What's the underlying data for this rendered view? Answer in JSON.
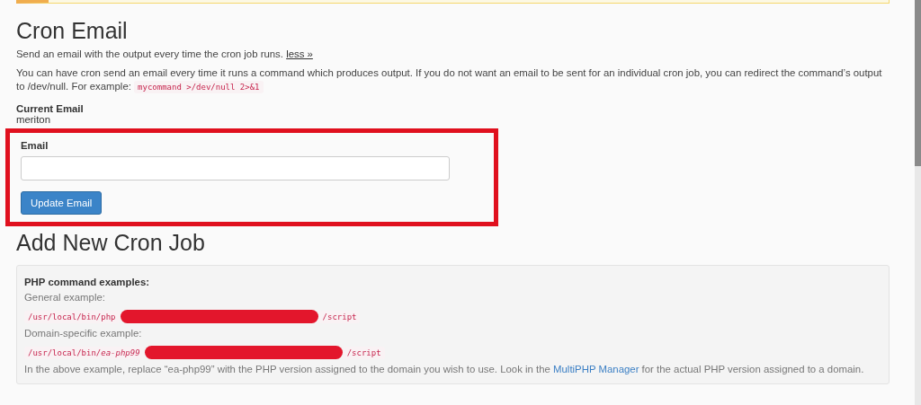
{
  "cron_email": {
    "title": "Cron Email",
    "summary": {
      "text": "Send an email with the output every time the cron job runs.",
      "link": "less »"
    },
    "description": {
      "text": "You can have cron send an email every time it runs a command which produces output. If you do not want an email to be sent for an individual cron job, you can redirect the command’s output to /dev/null. For example:",
      "code": "mycommand >/dev/null 2>&1"
    },
    "current_email": {
      "label": "Current Email",
      "value": "meriton"
    },
    "form": {
      "highlighted": true,
      "label": "Email",
      "button": "Update Email"
    }
  },
  "add_cron_job": {
    "title": "Add New Cron Job",
    "examples": {
      "heading": "PHP command examples:",
      "items": [
        {
          "label": "General example:",
          "prefix": "/usr/local/bin/php",
          "redacted": true,
          "suffix": "/script"
        },
        {
          "label": "Domain-specific example:",
          "prefix": "/usr/local/bin/*ea-php99*",
          "redacted": true,
          "suffix": "/script"
        }
      ],
      "note": {
        "before": "In the above example, replace “ea-php99” with the PHP version assigned to the domain you wish to use. Look in the",
        "link": "MultiPHP Manager",
        "after": "for the actual PHP version assigned to a domain."
      }
    }
  }
}
